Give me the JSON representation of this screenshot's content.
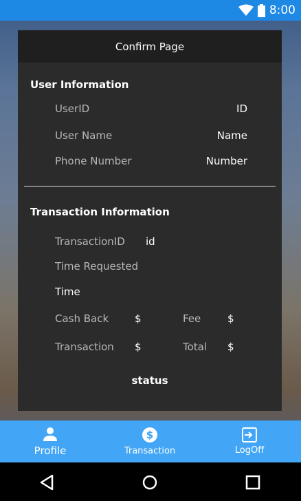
{
  "status_bar": {
    "time": "8:00",
    "color": "#1e88e5"
  },
  "dialog": {
    "title": "Confirm Page",
    "user_section": {
      "title": "User Information",
      "rows": [
        {
          "label": "UserID",
          "value": "ID"
        },
        {
          "label": "User Name",
          "value": "Name"
        },
        {
          "label": "Phone Number",
          "value": "Number"
        }
      ]
    },
    "transaction_section": {
      "title": "Transaction Information",
      "transaction_id_label": "TransactionID",
      "transaction_id_value": "id",
      "time_requested_label": "Time Requested",
      "time_value": "Time",
      "cash_back_label": "Cash Back",
      "cash_back_value": "$",
      "fee_label": "Fee",
      "fee_value": "$",
      "transaction_label": "Transaction",
      "transaction_value": "$",
      "total_label": "Total",
      "total_value": "$"
    },
    "status": "status"
  },
  "bottom_nav": {
    "color": "#42a5f5",
    "items": [
      {
        "label": "Profile",
        "icon": "person-icon"
      },
      {
        "label": "Transaction",
        "icon": "dollar-circle-icon"
      },
      {
        "label": "LogOff",
        "icon": "logout-icon"
      }
    ]
  },
  "system_nav": {
    "icons": [
      "back-icon",
      "home-icon",
      "recents-icon"
    ]
  }
}
